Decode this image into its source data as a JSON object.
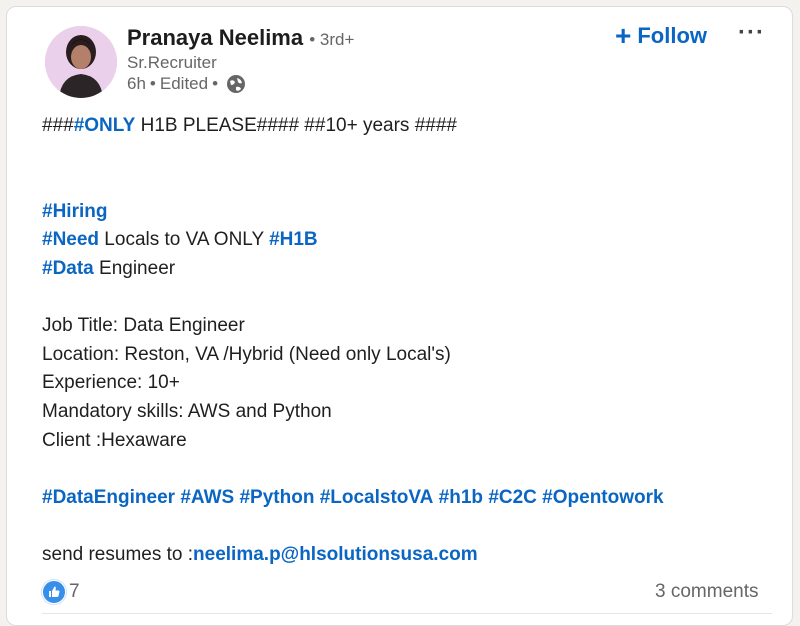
{
  "author": {
    "name": "Pranaya Neelima",
    "degree": "• 3rd+",
    "headline": "Sr.Recruiter",
    "time": "6h",
    "edited": "Edited",
    "visibility_icon": "globe-icon"
  },
  "actions": {
    "follow_label": "Follow",
    "follow_icon": "plus-icon",
    "menu_icon": "more-options-icon"
  },
  "post": {
    "line1_prefix": "###",
    "line1_tag": "#ONLY",
    "line1_rest": " H1B PLEASE#### ##10+ years ####",
    "hiring_tag": "#Hiring",
    "need_tag": "#Need",
    "need_text": " Locals to VA ONLY ",
    "h1b_tag": "#H1B",
    "data_tag": "#Data",
    "data_text": " Engineer",
    "job_title": "Job Title: Data Engineer",
    "location": "Location: Reston, VA /Hybrid (Need only Local's)",
    "experience": "Experience: 10+",
    "skills": "Mandatory skills: AWS and Python",
    "client": "Client :Hexaware",
    "hashtags": [
      "#DataEngineer",
      "#AWS",
      "#Python",
      "#LocalstoVA",
      "#h1b",
      "#C2C",
      "#Opentowork"
    ],
    "send_prefix": "send resumes to :",
    "email": "neelima.p@hlsolutionsusa.com"
  },
  "footer": {
    "reaction_icon": "like-icon",
    "reaction_count": "7",
    "comments": "3 comments"
  },
  "colors": {
    "link": "#0a66c2",
    "text": "#1f1f1f",
    "muted": "#666666",
    "like": "#378fe9"
  }
}
